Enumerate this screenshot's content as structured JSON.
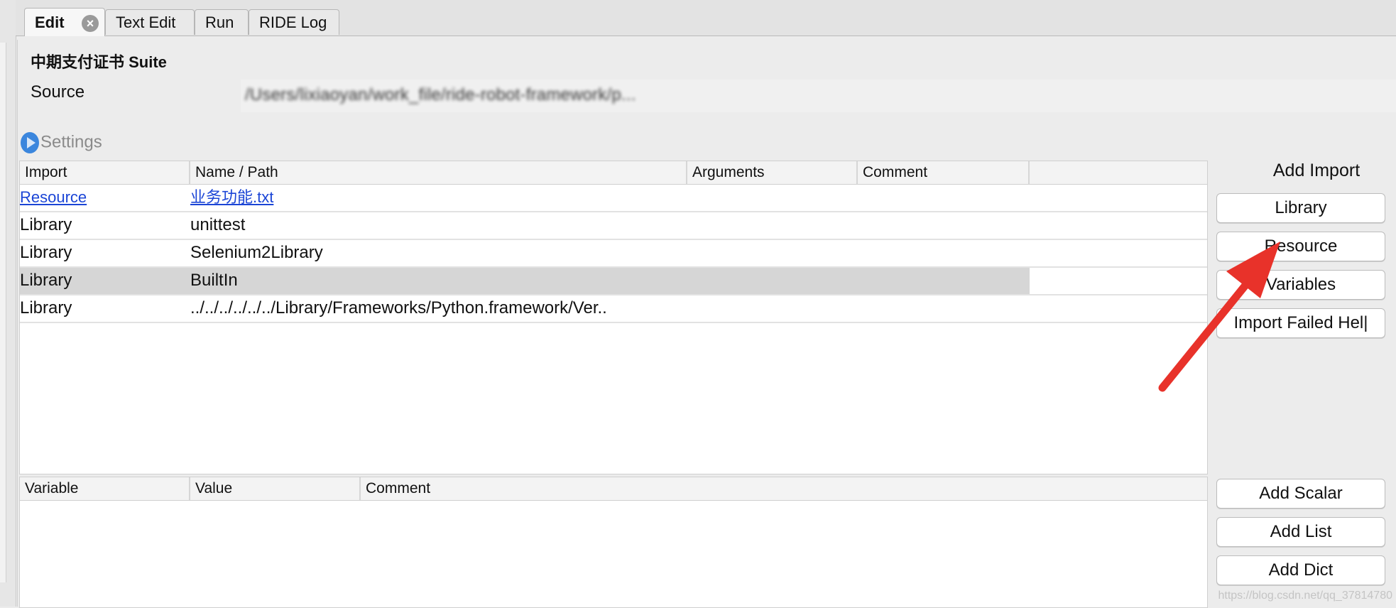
{
  "tabs": [
    {
      "label": "Edit",
      "active": true,
      "closable": true
    },
    {
      "label": "Text Edit"
    },
    {
      "label": "Run"
    },
    {
      "label": "RIDE Log"
    }
  ],
  "suite": {
    "title": "中期支付证书 Suite",
    "source_label": "Source",
    "source_value": "/Users/lixiaoyan/work_file/ride-robot-framework/p..."
  },
  "settings_label": "Settings",
  "imports": {
    "columns": [
      "Import",
      "Name / Path",
      "Arguments",
      "Comment"
    ],
    "rows": [
      {
        "type": "Resource",
        "name": "业务功能.txt",
        "link": true
      },
      {
        "type": "Library",
        "name": "unittest"
      },
      {
        "type": "Library",
        "name": "Selenium2Library"
      },
      {
        "type": "Library",
        "name": "BuiltIn",
        "selected": true
      },
      {
        "type": "Library",
        "name": "../../../../../../Library/Frameworks/Python.framework/Ver.."
      }
    ]
  },
  "add_import": {
    "title": "Add Import",
    "buttons": [
      "Library",
      "Resource",
      "Variables",
      "Import Failed Hel|"
    ]
  },
  "variables": {
    "columns": [
      "Variable",
      "Value",
      "Comment"
    ]
  },
  "variable_buttons": [
    "Add Scalar",
    "Add List",
    "Add Dict"
  ],
  "watermark": "https://blog.csdn.net/qq_37814780",
  "colors": {
    "link": "#1b45d6",
    "annotation_arrow": "#e8322a",
    "selection": "#d6d6d6"
  }
}
